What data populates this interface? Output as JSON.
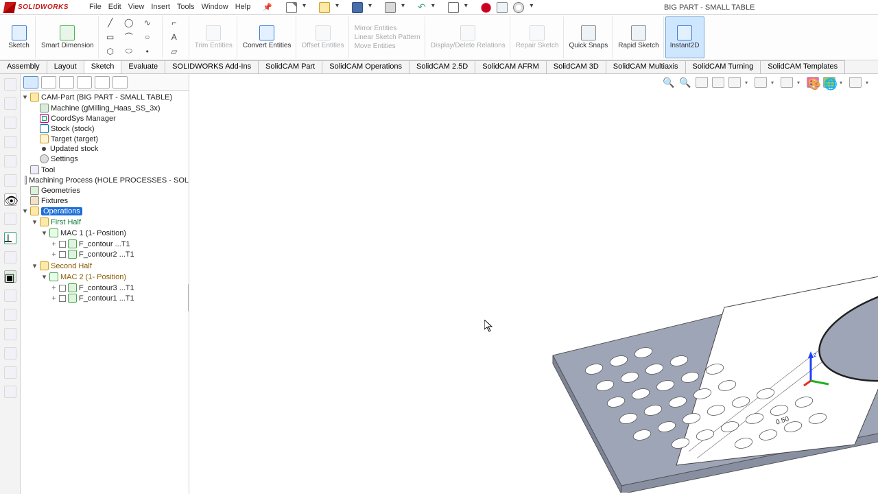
{
  "title_bar": {
    "logo_text": "SOLIDWORKS",
    "document": "BIG PART - SMALL TABLE",
    "menus": [
      "File",
      "Edit",
      "View",
      "Insert",
      "Tools",
      "Window",
      "Help"
    ]
  },
  "ribbon": {
    "sketch": "Sketch",
    "smart_dim": "Smart Dimension",
    "trim": "Trim Entities",
    "convert": "Convert Entities",
    "offset": "Offset Entities",
    "mirror": "Mirror Entities",
    "linear": "Linear Sketch Pattern",
    "move": "Move Entities",
    "display": "Display/Delete Relations",
    "repair": "Repair Sketch",
    "quick": "Quick Snaps",
    "rapid": "Rapid Sketch",
    "instant": "Instant2D"
  },
  "tabs": [
    "Assembly",
    "Layout",
    "Sketch",
    "Evaluate",
    "SOLIDWORKS Add-Ins",
    "SolidCAM Part",
    "SolidCAM Operations",
    "SolidCAM 2.5D",
    "SolidCAM AFRM",
    "SolidCAM 3D",
    "SolidCAM Multiaxis",
    "SolidCAM Turning",
    "SolidCAM Templates"
  ],
  "active_tab_index": 2,
  "tree": {
    "root": "CAM-Part (BIG PART - SMALL TABLE)",
    "machine": "Machine (gMilling_Haas_SS_3x)",
    "coordsys": "CoordSys Manager",
    "stock": "Stock (stock)",
    "target": "Target (target)",
    "updated": "Updated stock",
    "settings": "Settings",
    "tool": "Tool",
    "mproc": "Machining Process (HOLE PROCESSES - SOL",
    "geometries": "Geometries",
    "fixtures": "Fixtures",
    "operations": "Operations",
    "first_half": "First Half",
    "mac1": "MAC 1 (1- Position)",
    "op1": "F_contour ...T1",
    "op2": "F_contour2 ...T1",
    "second_half": "Second Half",
    "mac2": "MAC 2 (1- Position)",
    "op3": "F_contour3 ...T1",
    "op4": "F_contour1 ...T1"
  },
  "viewport": {
    "dimension_value": "0.50",
    "triad_z": "z"
  }
}
